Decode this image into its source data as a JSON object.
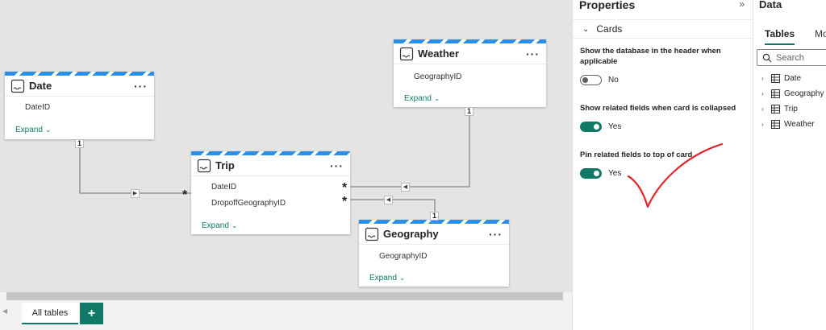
{
  "canvas": {
    "cards": {
      "date": {
        "title": "Date",
        "fields": [
          "DateID"
        ],
        "expand": "Expand"
      },
      "weather": {
        "title": "Weather",
        "fields": [
          "GeographyID"
        ],
        "expand": "Expand"
      },
      "trip": {
        "title": "Trip",
        "fields": [
          "DateID",
          "DropoffGeographyID"
        ],
        "expand": "Expand"
      },
      "geography": {
        "title": "Geography",
        "fields": [
          "GeographyID"
        ],
        "expand": "Expand"
      }
    },
    "relationships": {
      "one": "1",
      "many": "*"
    }
  },
  "bottom_bar": {
    "tab_all": "All tables",
    "tab_add": "+"
  },
  "properties": {
    "title": "Properties",
    "collapse_glyph": "»",
    "section": "Cards",
    "options": [
      {
        "label": "Show the database in the header when applicable",
        "state": "off",
        "value_text": "No"
      },
      {
        "label": "Show related fields when card is collapsed",
        "state": "on",
        "value_text": "Yes"
      },
      {
        "label": "Pin related fields to top of card",
        "state": "on",
        "value_text": "Yes"
      }
    ],
    "annotation_color": "#e0262b"
  },
  "data_pane": {
    "title": "Data",
    "tabs": [
      "Tables",
      "Mo"
    ],
    "search_placeholder": "Search",
    "tables": [
      "Date",
      "Geography",
      "Trip",
      "Weather"
    ]
  },
  "colors": {
    "accent": "#117865",
    "stripe": "#2b8fe8",
    "canvas": "#e5e4e3"
  }
}
